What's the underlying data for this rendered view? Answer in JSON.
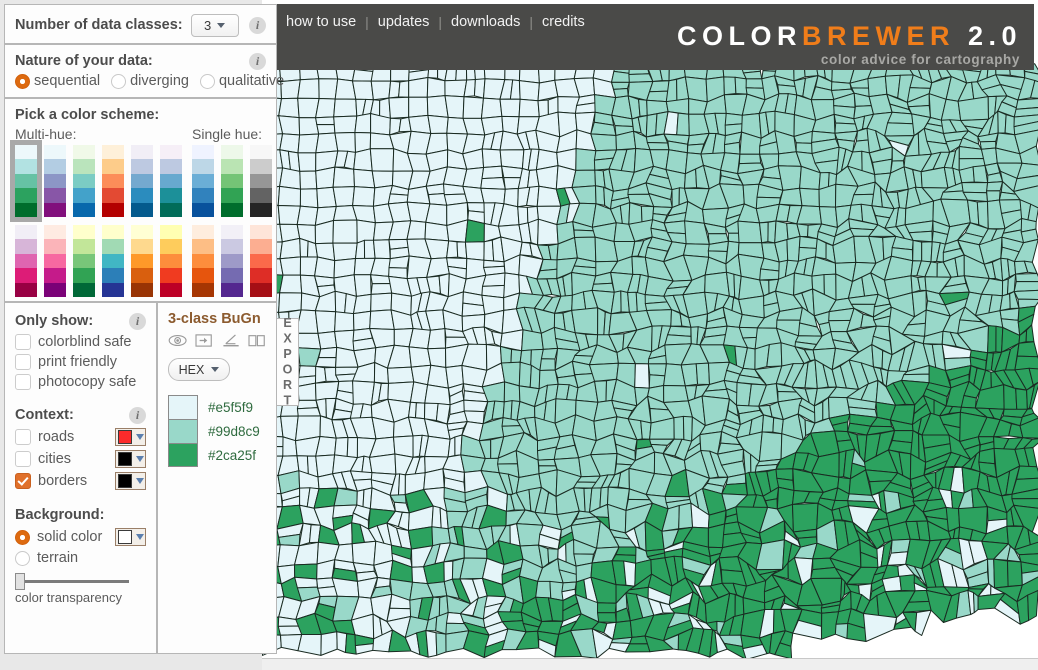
{
  "topnav": {
    "links": [
      "how to use",
      "updates",
      "downloads",
      "credits"
    ],
    "separator": "|"
  },
  "logo": {
    "part_white_1": "COLOR",
    "part_orange": "BREWER",
    "part_white_2": " 2.0",
    "tagline": "color advice for cartography",
    "color_white": "#ffffff",
    "color_orange": "#f07d1a",
    "color_tagline": "#a8a8a5",
    "bar_color": "#4a4a48"
  },
  "classes_panel": {
    "label": "Number of data classes:",
    "selected": "3",
    "info": "i",
    "icon": "chevron-down-icon"
  },
  "nature_panel": {
    "label": "Nature of your data:",
    "info": "i",
    "options": [
      {
        "label": "sequential",
        "selected": true
      },
      {
        "label": "diverging",
        "selected": false
      },
      {
        "label": "qualitative",
        "selected": false
      }
    ]
  },
  "scheme_panel": {
    "title": "Pick a color scheme:",
    "multi_hue_label": "Multi-hue:",
    "single_hue_label": "Single hue:",
    "selected_scheme": "BuGn",
    "selection_outline_color": "#a9a9a9",
    "multi_hue": [
      {
        "name": "BuGn",
        "colors": [
          "#edf8fb",
          "#b2e2e2",
          "#66c2a4",
          "#2ca25f",
          "#006d2c"
        ]
      },
      {
        "name": "BuPu",
        "colors": [
          "#edf8fb",
          "#b3cde3",
          "#8c96c6",
          "#8856a7",
          "#810f7c"
        ]
      },
      {
        "name": "GnBu",
        "colors": [
          "#f0f9e8",
          "#bae4bc",
          "#7bccc4",
          "#43a2ca",
          "#0868ac"
        ]
      },
      {
        "name": "OrRd",
        "colors": [
          "#fef0d9",
          "#fdcc8a",
          "#fc8d59",
          "#e34a33",
          "#b30000"
        ]
      },
      {
        "name": "PuBu",
        "colors": [
          "#f1eef6",
          "#bdc9e1",
          "#74a9cf",
          "#2b8cbe",
          "#045a8d"
        ]
      },
      {
        "name": "PuBuGn",
        "colors": [
          "#f6eff7",
          "#bdc9e1",
          "#67a9cf",
          "#1c9099",
          "#016c59"
        ]
      },
      {
        "name": "PuRd",
        "colors": [
          "#f1eef6",
          "#d7b5d8",
          "#df65b0",
          "#dd1c77",
          "#980043"
        ]
      },
      {
        "name": "RdPu",
        "colors": [
          "#feebe2",
          "#fbb4b9",
          "#f768a1",
          "#c51b8a",
          "#7a0177"
        ]
      },
      {
        "name": "YlGn",
        "colors": [
          "#ffffcc",
          "#c2e699",
          "#78c679",
          "#31a354",
          "#006837"
        ]
      },
      {
        "name": "YlGnBu",
        "colors": [
          "#ffffcc",
          "#a1dab4",
          "#41b6c4",
          "#2c7fb8",
          "#253494"
        ]
      },
      {
        "name": "YlOrBr",
        "colors": [
          "#ffffd4",
          "#fed98e",
          "#fe9929",
          "#d95f0e",
          "#993404"
        ]
      },
      {
        "name": "YlOrRd",
        "colors": [
          "#ffffb2",
          "#fecc5c",
          "#fd8d3c",
          "#f03b20",
          "#bd0026"
        ]
      }
    ],
    "single_hue": [
      {
        "name": "Blues",
        "colors": [
          "#eff3ff",
          "#bdd7e7",
          "#6baed6",
          "#3182bd",
          "#08519c"
        ]
      },
      {
        "name": "Greens",
        "colors": [
          "#edf8e9",
          "#bae4b3",
          "#74c476",
          "#31a354",
          "#006d2c"
        ]
      },
      {
        "name": "Greys",
        "colors": [
          "#f7f7f7",
          "#cccccc",
          "#969696",
          "#636363",
          "#252525"
        ]
      },
      {
        "name": "Oranges",
        "colors": [
          "#feedde",
          "#fdbe85",
          "#fd8d3c",
          "#e6550d",
          "#a63603"
        ]
      },
      {
        "name": "Purples",
        "colors": [
          "#f2f0f7",
          "#cbc9e2",
          "#9e9ac8",
          "#756bb1",
          "#54278f"
        ]
      },
      {
        "name": "Reds",
        "colors": [
          "#fee5d9",
          "#fcae91",
          "#fb6a4a",
          "#de2d26",
          "#a50f15"
        ]
      }
    ]
  },
  "only_show": {
    "title": "Only show:",
    "info": "i",
    "items": [
      {
        "label": "colorblind safe",
        "checked": false
      },
      {
        "label": "print friendly",
        "checked": false
      },
      {
        "label": "photocopy safe",
        "checked": false
      }
    ]
  },
  "context": {
    "title": "Context:",
    "info": "i",
    "items": [
      {
        "label": "roads",
        "checked": false,
        "color": "#fb2b2b"
      },
      {
        "label": "cities",
        "checked": false,
        "color": "#000000"
      },
      {
        "label": "borders",
        "checked": true,
        "color": "#000000"
      }
    ]
  },
  "background": {
    "title": "Background:",
    "options": [
      {
        "label": "solid color",
        "selected": true,
        "color": "#ffffff"
      },
      {
        "label": "terrain",
        "selected": false
      }
    ],
    "transparency_label": "color transparency",
    "transparency_value": 0
  },
  "detail": {
    "title": "3-class BuGn",
    "icons": [
      "eye-icon",
      "print-export-icon",
      "photocopy-icon",
      "book-icon"
    ],
    "format_selected": "HEX",
    "swatches": [
      {
        "hex": "#e5f5f9",
        "label": "#e5f5f9"
      },
      {
        "hex": "#99d8c9",
        "label": "#99d8c9"
      },
      {
        "hex": "#2ca25f",
        "label": "#2ca25f"
      }
    ]
  },
  "export_tab": {
    "label": "EXPORT"
  },
  "map": {
    "title": "us-counties-choropleth",
    "class_colors": [
      "#e5f5f9",
      "#99d8c9",
      "#2ca25f"
    ],
    "border_color": "#1a2b22",
    "background": "#ffffff"
  }
}
